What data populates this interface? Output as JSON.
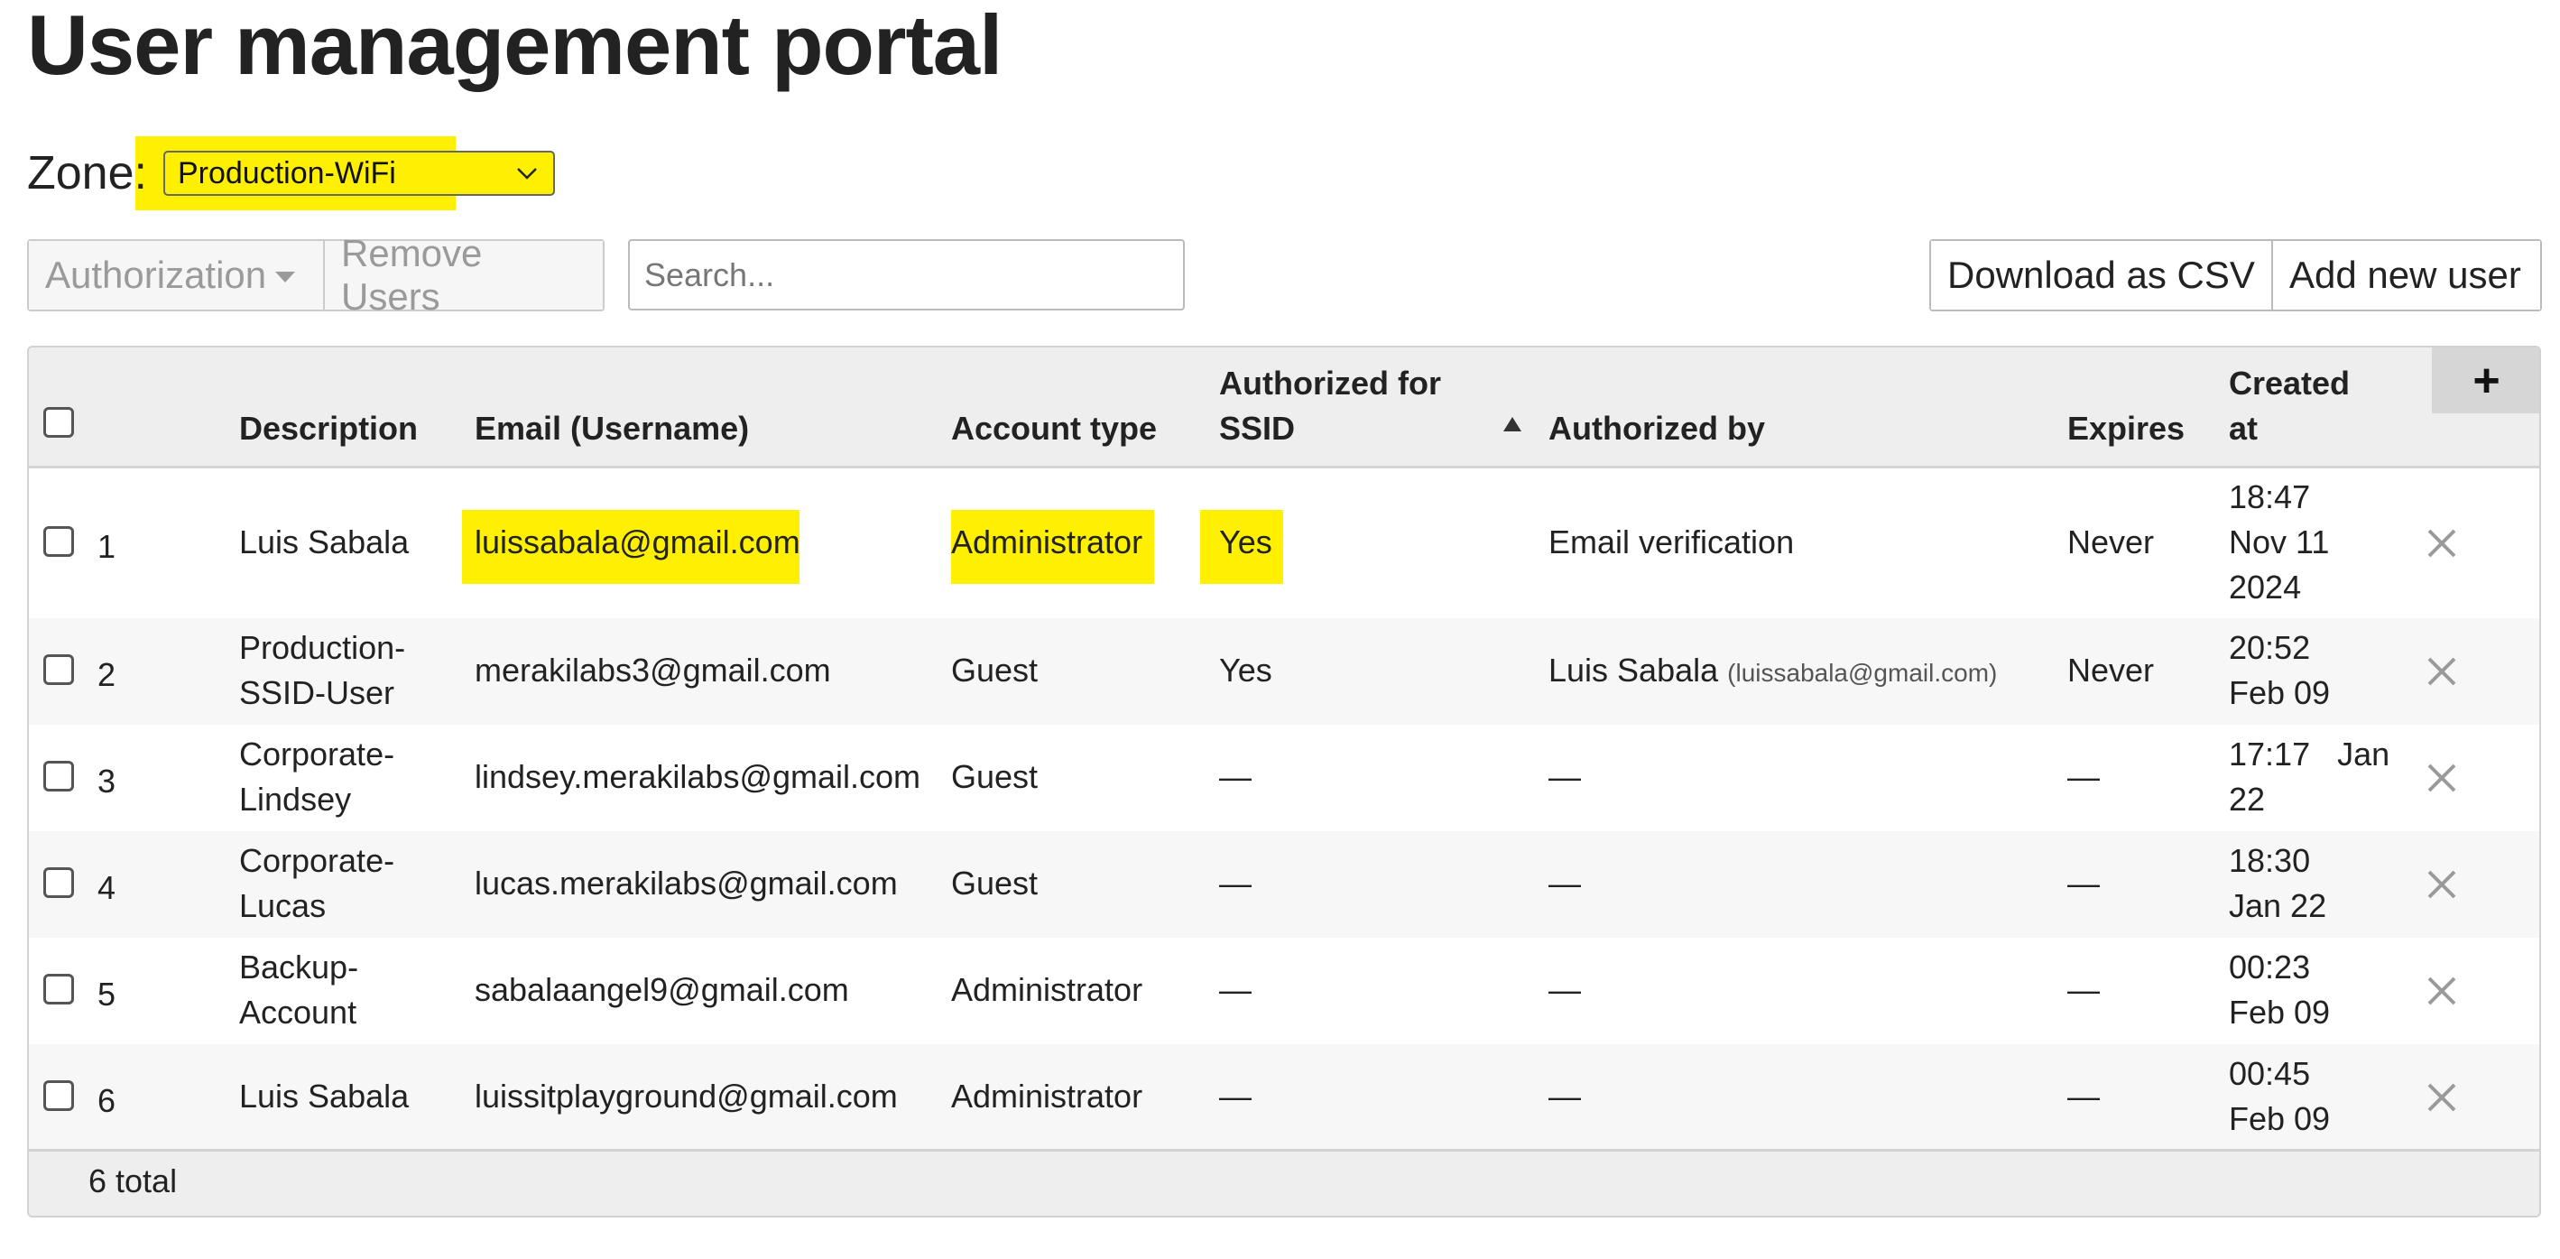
{
  "page": {
    "title": "User management portal"
  },
  "zone": {
    "label": "Zone:",
    "selected": "Production-WiFi"
  },
  "toolbar": {
    "authorization_label": "Authorization",
    "remove_label": "Remove Users",
    "search_placeholder": "Search...",
    "download_label": "Download as CSV",
    "add_label": "Add new user"
  },
  "table": {
    "headers": {
      "description": "Description",
      "email": "Email (Username)",
      "account_type": "Account type",
      "authorized_for_line1": "Authorized for",
      "authorized_for_line2": "SSID",
      "authorized_by": "Authorized by",
      "expires": "Expires",
      "created_line1": "Created",
      "created_line2": "at",
      "add_column": "+"
    },
    "rows": [
      {
        "num": "1",
        "description": [
          "Luis Sabala"
        ],
        "email": "luissabala@gmail.com",
        "account_type": "Administrator",
        "authorized": "Yes",
        "authorized_by": "Email verification",
        "authorized_by_detail": "",
        "expires": "Never",
        "created": [
          "18:47",
          "Nov 11",
          "2024"
        ],
        "highlighted": true
      },
      {
        "num": "2",
        "description": [
          "Production-",
          "SSID-User"
        ],
        "email": "merakilabs3@gmail.com",
        "account_type": "Guest",
        "authorized": "Yes",
        "authorized_by": "Luis Sabala",
        "authorized_by_detail": "(luissabala@gmail.com)",
        "expires": "Never",
        "created": [
          "20:52",
          "Feb 09"
        ]
      },
      {
        "num": "3",
        "description": [
          "Corporate-",
          "Lindsey"
        ],
        "email": "lindsey.merakilabs@gmail.com",
        "account_type": "Guest",
        "authorized": "—",
        "authorized_by": "—",
        "authorized_by_detail": "",
        "expires": "—",
        "created": [
          "17:17   Jan",
          "22"
        ]
      },
      {
        "num": "4",
        "description": [
          "Corporate-",
          "Lucas"
        ],
        "email": "lucas.merakilabs@gmail.com",
        "account_type": "Guest",
        "authorized": "—",
        "authorized_by": "—",
        "authorized_by_detail": "",
        "expires": "—",
        "created": [
          "18:30",
          "Jan 22"
        ]
      },
      {
        "num": "5",
        "description": [
          "Backup-",
          "Account"
        ],
        "email": "sabalaangel9@gmail.com",
        "account_type": "Administrator",
        "authorized": "—",
        "authorized_by": "—",
        "authorized_by_detail": "",
        "expires": "—",
        "created": [
          "00:23",
          "Feb 09"
        ]
      },
      {
        "num": "6",
        "description": [
          "Luis Sabala"
        ],
        "email": "luissitplayground@gmail.com",
        "account_type": "Administrator",
        "authorized": "—",
        "authorized_by": "—",
        "authorized_by_detail": "",
        "expires": "—",
        "created": [
          "00:45",
          "Feb 09"
        ]
      }
    ],
    "footer": "6 total"
  },
  "colors": {
    "highlight": "#ffef00",
    "header_bg": "#eeeeee",
    "alt_row": "#f7f7f7",
    "remove_icon": "#9a9a9a"
  },
  "icons": {
    "zone_dropdown": "chevron-down-icon",
    "remove_row": "close-icon",
    "sort": "sort-ascending-icon",
    "add_column": "plus-icon",
    "authorization_menu": "caret-down-icon"
  }
}
